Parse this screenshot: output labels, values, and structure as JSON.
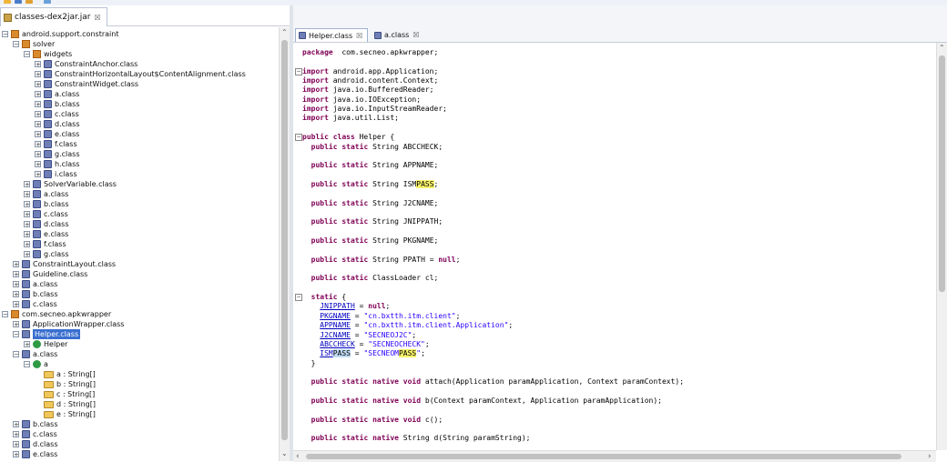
{
  "jar_tab": {
    "label": "classes-dex2jar.jar",
    "close": "☒"
  },
  "tree": [
    {
      "label": "android.support.constraint",
      "depth": 0,
      "icon": "pkg",
      "exp": "−"
    },
    {
      "label": "solver",
      "depth": 1,
      "icon": "pkg",
      "exp": "−"
    },
    {
      "label": "widgets",
      "depth": 2,
      "icon": "pkg",
      "exp": "−"
    },
    {
      "label": "ConstraintAnchor.class",
      "depth": 3,
      "icon": "class",
      "exp": "+"
    },
    {
      "label": "ConstraintHorizontalLayout$ContentAlignment.class",
      "depth": 3,
      "icon": "class",
      "exp": "+"
    },
    {
      "label": "ConstraintWidget.class",
      "depth": 3,
      "icon": "class",
      "exp": "+"
    },
    {
      "label": "a.class",
      "depth": 3,
      "icon": "class",
      "exp": "+"
    },
    {
      "label": "b.class",
      "depth": 3,
      "icon": "class",
      "exp": "+"
    },
    {
      "label": "c.class",
      "depth": 3,
      "icon": "class",
      "exp": "+"
    },
    {
      "label": "d.class",
      "depth": 3,
      "icon": "class",
      "exp": "+"
    },
    {
      "label": "e.class",
      "depth": 3,
      "icon": "class",
      "exp": "+"
    },
    {
      "label": "f.class",
      "depth": 3,
      "icon": "class",
      "exp": "+"
    },
    {
      "label": "g.class",
      "depth": 3,
      "icon": "class",
      "exp": "+"
    },
    {
      "label": "h.class",
      "depth": 3,
      "icon": "class",
      "exp": "+"
    },
    {
      "label": "i.class",
      "depth": 3,
      "icon": "class",
      "exp": "+"
    },
    {
      "label": "SolverVariable.class",
      "depth": 2,
      "icon": "class",
      "exp": "+"
    },
    {
      "label": "a.class",
      "depth": 2,
      "icon": "class",
      "exp": "+"
    },
    {
      "label": "b.class",
      "depth": 2,
      "icon": "class",
      "exp": "+"
    },
    {
      "label": "c.class",
      "depth": 2,
      "icon": "class",
      "exp": "+"
    },
    {
      "label": "d.class",
      "depth": 2,
      "icon": "class",
      "exp": "+"
    },
    {
      "label": "e.class",
      "depth": 2,
      "icon": "class",
      "exp": "+"
    },
    {
      "label": "f.class",
      "depth": 2,
      "icon": "class",
      "exp": "+"
    },
    {
      "label": "g.class",
      "depth": 2,
      "icon": "class",
      "exp": "+"
    },
    {
      "label": "ConstraintLayout.class",
      "depth": 1,
      "icon": "class",
      "exp": "+"
    },
    {
      "label": "Guideline.class",
      "depth": 1,
      "icon": "class",
      "exp": "+"
    },
    {
      "label": "a.class",
      "depth": 1,
      "icon": "class",
      "exp": "+"
    },
    {
      "label": "b.class",
      "depth": 1,
      "icon": "class",
      "exp": "+"
    },
    {
      "label": "c.class",
      "depth": 1,
      "icon": "class",
      "exp": "+"
    },
    {
      "label": "com.secneo.apkwrapper",
      "depth": 0,
      "icon": "pkg",
      "exp": "−"
    },
    {
      "label": "ApplicationWrapper.class",
      "depth": 1,
      "icon": "class",
      "exp": "+"
    },
    {
      "label": "Helper.class",
      "depth": 1,
      "icon": "class",
      "exp": "−",
      "selected": true
    },
    {
      "label": "Helper",
      "depth": 2,
      "icon": "c",
      "exp": "+"
    },
    {
      "label": "a.class",
      "depth": 1,
      "icon": "class",
      "exp": "−"
    },
    {
      "label": "a",
      "depth": 2,
      "icon": "c",
      "exp": "−"
    },
    {
      "label": "a : String[]",
      "depth": 3,
      "icon": "field",
      "exp": ""
    },
    {
      "label": "b : String[]",
      "depth": 3,
      "icon": "field",
      "exp": ""
    },
    {
      "label": "c : String[]",
      "depth": 3,
      "icon": "field",
      "exp": ""
    },
    {
      "label": "d : String[]",
      "depth": 3,
      "icon": "field",
      "exp": ""
    },
    {
      "label": "e : String[]",
      "depth": 3,
      "icon": "field",
      "exp": ""
    },
    {
      "label": "b.class",
      "depth": 1,
      "icon": "class",
      "exp": "+"
    },
    {
      "label": "c.class",
      "depth": 1,
      "icon": "class",
      "exp": "+"
    },
    {
      "label": "d.class",
      "depth": 1,
      "icon": "class",
      "exp": "+"
    },
    {
      "label": "e.class",
      "depth": 1,
      "icon": "class",
      "exp": "+"
    }
  ],
  "editor_tabs": [
    {
      "label": "Helper.class",
      "close": "☒",
      "active": true
    },
    {
      "label": "a.class",
      "close": "☒",
      "active": false
    }
  ],
  "code": [
    {
      "line": 0,
      "tokens": [
        [
          "kw",
          "package"
        ],
        [
          "",
          "  com.secneo.apkwrapper;"
        ]
      ]
    },
    {
      "line": 2,
      "fold": "−",
      "tokens": [
        [
          "kw",
          "import"
        ],
        [
          "",
          " android.app.Application;"
        ]
      ]
    },
    {
      "line": 3,
      "tokens": [
        [
          "kw",
          "import"
        ],
        [
          "",
          " android.content.Context;"
        ]
      ]
    },
    {
      "line": 4,
      "tokens": [
        [
          "kw",
          "import"
        ],
        [
          "",
          " java.io.BufferedReader;"
        ]
      ]
    },
    {
      "line": 5,
      "tokens": [
        [
          "kw",
          "import"
        ],
        [
          "",
          " java.io.IOException;"
        ]
      ]
    },
    {
      "line": 6,
      "tokens": [
        [
          "kw",
          "import"
        ],
        [
          "",
          " java.io.InputStreamReader;"
        ]
      ]
    },
    {
      "line": 7,
      "tokens": [
        [
          "kw",
          "import"
        ],
        [
          "",
          " java.util.List;"
        ]
      ]
    },
    {
      "line": 9,
      "fold": "−",
      "tokens": [
        [
          "kw",
          "public class"
        ],
        [
          "",
          " Helper {"
        ]
      ]
    },
    {
      "line": 10,
      "tokens": [
        [
          "",
          "  "
        ],
        [
          "kw",
          "public static"
        ],
        [
          "",
          " String ABCCHECK;"
        ]
      ]
    },
    {
      "line": 12,
      "tokens": [
        [
          "",
          "  "
        ],
        [
          "kw",
          "public static"
        ],
        [
          "",
          " String APPNAME;"
        ]
      ]
    },
    {
      "line": 14,
      "tokens": [
        [
          "",
          "  "
        ],
        [
          "kw",
          "public static"
        ],
        [
          "",
          " String ISM"
        ],
        [
          "hl",
          "PASS"
        ],
        [
          "",
          ";"
        ]
      ]
    },
    {
      "line": 16,
      "tokens": [
        [
          "",
          "  "
        ],
        [
          "kw",
          "public static"
        ],
        [
          "",
          " String J2CNAME;"
        ]
      ]
    },
    {
      "line": 18,
      "tokens": [
        [
          "",
          "  "
        ],
        [
          "kw",
          "public static"
        ],
        [
          "",
          " String JNIPPATH;"
        ]
      ]
    },
    {
      "line": 20,
      "tokens": [
        [
          "",
          "  "
        ],
        [
          "kw",
          "public static"
        ],
        [
          "",
          " String PKGNAME;"
        ]
      ]
    },
    {
      "line": 22,
      "tokens": [
        [
          "",
          "  "
        ],
        [
          "kw",
          "public static"
        ],
        [
          "",
          " String PPATH = "
        ],
        [
          "kw",
          "null"
        ],
        [
          "",
          ";"
        ]
      ]
    },
    {
      "line": 24,
      "tokens": [
        [
          "",
          "  "
        ],
        [
          "kw",
          "public static"
        ],
        [
          "",
          " ClassLoader cl;"
        ]
      ]
    },
    {
      "line": 26,
      "fold": "−",
      "tokens": [
        [
          "",
          "  "
        ],
        [
          "kw",
          "static"
        ],
        [
          "",
          " {"
        ]
      ]
    },
    {
      "line": 27,
      "tokens": [
        [
          "",
          "    "
        ],
        [
          "fld",
          "JNIPPATH"
        ],
        [
          "",
          " = "
        ],
        [
          "kw",
          "null"
        ],
        [
          "",
          ";"
        ]
      ]
    },
    {
      "line": 28,
      "tokens": [
        [
          "",
          "    "
        ],
        [
          "fld",
          "PKGNAME"
        ],
        [
          "",
          " = "
        ],
        [
          "str",
          "\"cn.bxtth.itm.client\""
        ],
        [
          "",
          ";"
        ]
      ]
    },
    {
      "line": 29,
      "tokens": [
        [
          "",
          "    "
        ],
        [
          "fld",
          "APPNAME"
        ],
        [
          "",
          " = "
        ],
        [
          "str",
          "\"cn.bxtth.itm.client.Application\""
        ],
        [
          "",
          ";"
        ]
      ]
    },
    {
      "line": 30,
      "tokens": [
        [
          "",
          "    "
        ],
        [
          "fld",
          "J2CNAME"
        ],
        [
          "",
          " = "
        ],
        [
          "str",
          "\"SECNEOJ2C\""
        ],
        [
          "",
          ";"
        ]
      ]
    },
    {
      "line": 31,
      "tokens": [
        [
          "",
          "    "
        ],
        [
          "fld",
          "ABCCHECK"
        ],
        [
          "",
          " = "
        ],
        [
          "str",
          "\"SECNEOCHECK\""
        ],
        [
          "",
          ";"
        ]
      ]
    },
    {
      "line": 32,
      "tokens": [
        [
          "",
          "    "
        ],
        [
          "fld",
          "ISM"
        ],
        [
          "hlb",
          "PASS"
        ],
        [
          "",
          " = "
        ],
        [
          "str",
          "\"SECNEOM"
        ],
        [
          "hl",
          "PASS"
        ],
        [
          "str",
          "\""
        ],
        [
          "",
          ";"
        ]
      ]
    },
    {
      "line": 33,
      "tokens": [
        [
          "",
          "  }"
        ]
      ]
    },
    {
      "line": 35,
      "tokens": [
        [
          "",
          "  "
        ],
        [
          "kw",
          "public static native void"
        ],
        [
          "",
          " attach(Application paramApplication, Context paramContext);"
        ]
      ]
    },
    {
      "line": 37,
      "tokens": [
        [
          "",
          "  "
        ],
        [
          "kw",
          "public static native void"
        ],
        [
          "",
          " b(Context paramContext, Application paramApplication);"
        ]
      ]
    },
    {
      "line": 39,
      "tokens": [
        [
          "",
          "  "
        ],
        [
          "kw",
          "public static native void"
        ],
        [
          "",
          " c();"
        ]
      ]
    },
    {
      "line": 41,
      "tokens": [
        [
          "",
          "  "
        ],
        [
          "kw",
          "public static native"
        ],
        [
          "",
          " String d(String paramString);"
        ]
      ]
    }
  ],
  "scroll": {
    "up": "⌃",
    "down": "⌄",
    "left": "‹",
    "right": "›"
  }
}
